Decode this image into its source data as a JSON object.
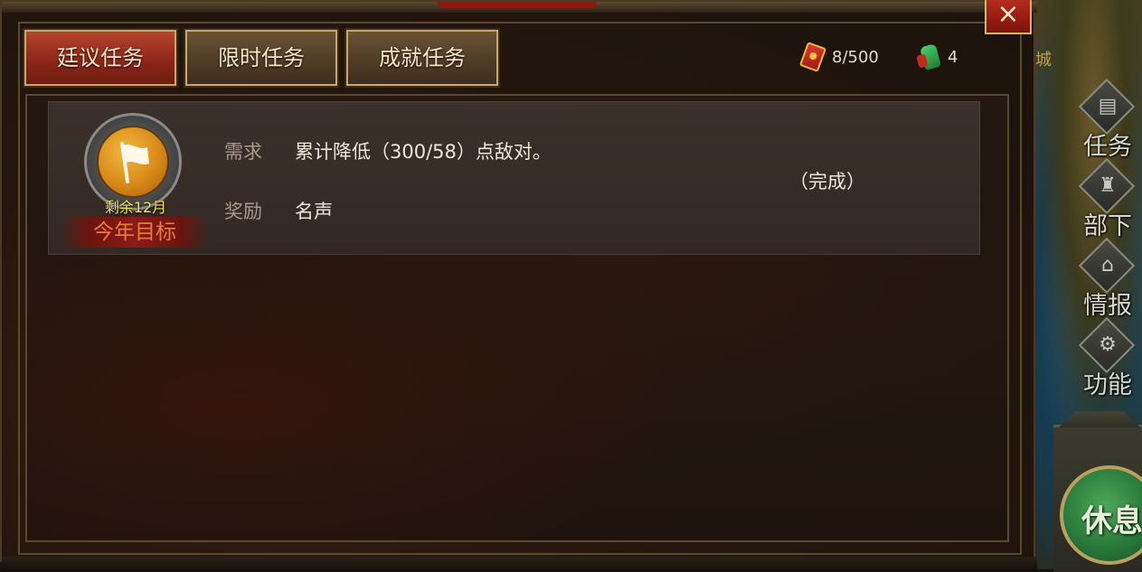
{
  "window": {
    "close_label": "×"
  },
  "tabs": [
    {
      "label": "廷议任务",
      "active": true
    },
    {
      "label": "限时任务",
      "active": false
    },
    {
      "label": "成就任务",
      "active": false
    }
  ],
  "resources": {
    "token": {
      "icon": "red-token-icon",
      "value": "8/500"
    },
    "jade": {
      "icon": "jade-icon",
      "value": "4"
    }
  },
  "task": {
    "badge_remaining": "剩余12月",
    "badge_title": "今年目标",
    "requirement_label": "需求",
    "requirement_value": "累计降低（300/58）点敌对。",
    "reward_label": "奖励",
    "reward_value": "名声",
    "status": "（完成）"
  },
  "sidebar": {
    "map_text": "城",
    "items": [
      {
        "label": "任务",
        "icon": "scroll-icon"
      },
      {
        "label": "部下",
        "icon": "helmet-icon"
      },
      {
        "label": "情报",
        "icon": "building-icon"
      },
      {
        "label": "功能",
        "icon": "gears-icon"
      }
    ],
    "rest_label": "休息"
  },
  "colors": {
    "active_tab": "#8a2518",
    "inactive_tab": "#4e3b25",
    "badge_gold": "#d88a18",
    "remaining_text": "#f5e05a",
    "badge_title": "#f07a3a"
  }
}
